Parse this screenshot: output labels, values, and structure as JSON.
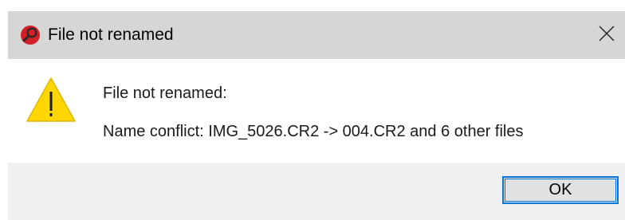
{
  "window": {
    "title": "File not renamed",
    "app_icon": "red-magnifier-icon",
    "close_icon": "close-icon"
  },
  "message": {
    "icon": "warning-icon",
    "line1": "File not renamed:",
    "line2": "Name conflict: IMG_5026.CR2 -> 004.CR2 and 6 other files"
  },
  "buttons": {
    "ok_label": "OK"
  },
  "colors": {
    "titlebar": "#d6d6d6",
    "footer": "#f0f0f0",
    "accent": "#0078d7",
    "warning": "#ffd700"
  }
}
